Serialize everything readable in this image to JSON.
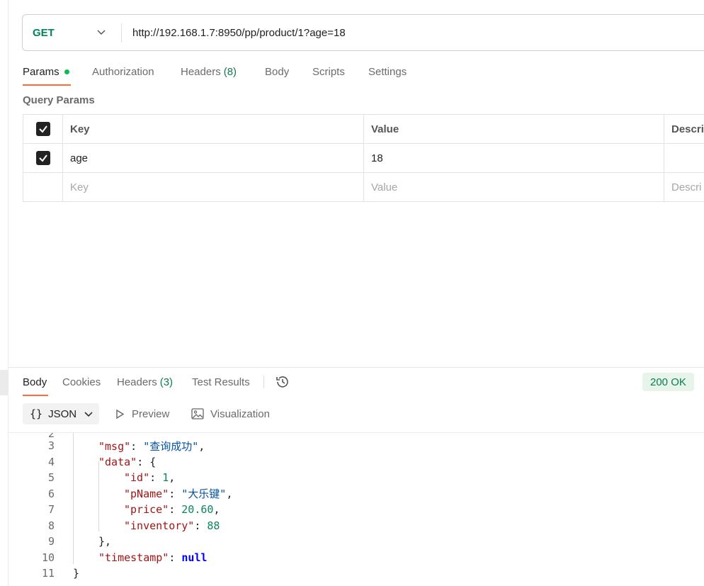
{
  "request": {
    "method": "GET",
    "url": "http://192.168.1.7:8950/pp/product/1?age=18"
  },
  "request_tabs": [
    {
      "label": "Params",
      "count": ""
    },
    {
      "label": "Authorization",
      "count": ""
    },
    {
      "label": "Headers",
      "count": "(8)"
    },
    {
      "label": "Body",
      "count": ""
    },
    {
      "label": "Scripts",
      "count": ""
    },
    {
      "label": "Settings",
      "count": ""
    }
  ],
  "query_params": {
    "title": "Query Params",
    "headers": {
      "key": "Key",
      "value": "Value",
      "description": "Descri"
    },
    "rows": [
      {
        "key": "age",
        "value": "18",
        "checked": true
      }
    ],
    "placeholder": {
      "key": "Key",
      "value": "Value",
      "description": "Descri"
    }
  },
  "response_tabs": [
    {
      "label": "Body",
      "count": ""
    },
    {
      "label": "Cookies",
      "count": ""
    },
    {
      "label": "Headers",
      "count": "(3)"
    },
    {
      "label": "Test Results",
      "count": ""
    }
  ],
  "status": "200 OK",
  "body_format": {
    "selected": "JSON",
    "braces": "{}"
  },
  "view_options": {
    "preview": "Preview",
    "visualization": "Visualization"
  },
  "code_lines": [
    {
      "n": "3",
      "key": "\"msg\"",
      "sep": ": ",
      "val": "\"查询成功\"",
      "vt": "s",
      "tail": ","
    },
    {
      "n": "4",
      "key": "\"data\"",
      "sep": ": ",
      "val": "",
      "vt": "p",
      "tail": "{"
    },
    {
      "n": "5",
      "key": "\"id\"",
      "sep": ": ",
      "val": "1",
      "vt": "n",
      "tail": ","
    },
    {
      "n": "6",
      "key": "\"pName\"",
      "sep": ": ",
      "val": "\"大乐键\"",
      "vt": "s",
      "tail": ","
    },
    {
      "n": "7",
      "key": "\"price\"",
      "sep": ": ",
      "val": "20.60",
      "vt": "n",
      "tail": ","
    },
    {
      "n": "8",
      "key": "\"inventory\"",
      "sep": ": ",
      "val": "88",
      "vt": "n",
      "tail": ""
    },
    {
      "n": "9",
      "key": "",
      "sep": "",
      "val": "",
      "vt": "p",
      "tail": "},"
    },
    {
      "n": "10",
      "key": "\"timestamp\"",
      "sep": ": ",
      "val": "null",
      "vt": "kw",
      "tail": ""
    },
    {
      "n": "11",
      "key": "",
      "sep": "",
      "val": "",
      "vt": "p",
      "tail": "}"
    }
  ],
  "colors": {
    "accent": "#ff6c37",
    "get": "#00845a",
    "ok": "#0f7b4d"
  }
}
